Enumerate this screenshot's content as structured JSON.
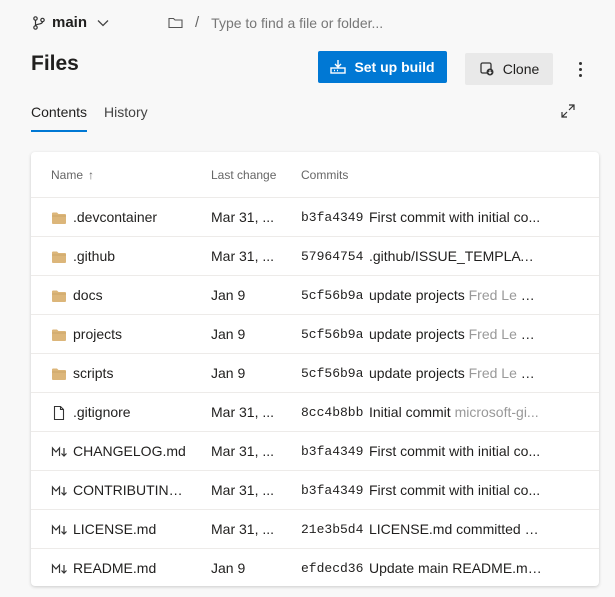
{
  "topbar": {
    "branch": "main",
    "path_placeholder": "Type to find a file or folder...",
    "separator": "/"
  },
  "page": {
    "title": "Files",
    "setup_build_label": "Set up build",
    "clone_label": "Clone"
  },
  "tabs": [
    {
      "label": "Contents",
      "active": true
    },
    {
      "label": "History",
      "active": false
    }
  ],
  "table": {
    "columns": {
      "name": "Name",
      "sort_indicator": "↑",
      "last_change": "Last change",
      "commits": "Commits"
    },
    "rows": [
      {
        "icon": "folder-icon",
        "name": ".devcontainer",
        "last_change": "Mar 31, ...",
        "hash": "b3fa4349",
        "message": "First commit with initial co...",
        "author": ""
      },
      {
        "icon": "folder-icon",
        "name": ".github",
        "last_change": "Mar 31, ...",
        "hash": "57964754",
        "message": ".github/ISSUE_TEMPLATE....",
        "author": ""
      },
      {
        "icon": "folder-icon",
        "name": "docs",
        "last_change": "Jan 9",
        "hash": "5cf56b9a",
        "message": "update projects ",
        "author": "Fred Le C..."
      },
      {
        "icon": "folder-icon",
        "name": "projects",
        "last_change": "Jan 9",
        "hash": "5cf56b9a",
        "message": "update projects ",
        "author": "Fred Le C..."
      },
      {
        "icon": "folder-icon",
        "name": "scripts",
        "last_change": "Jan 9",
        "hash": "5cf56b9a",
        "message": "update projects ",
        "author": "Fred Le C..."
      },
      {
        "icon": "file-icon",
        "name": ".gitignore",
        "last_change": "Mar 31, ...",
        "hash": "8cc4b8bb",
        "message": "Initial commit ",
        "author": "microsoft-gi..."
      },
      {
        "icon": "markdown-icon",
        "name": "CHANGELOG.md",
        "last_change": "Mar 31, ...",
        "hash": "b3fa4349",
        "message": "First commit with initial co...",
        "author": ""
      },
      {
        "icon": "markdown-icon",
        "name": "CONTRIBUTING....",
        "last_change": "Mar 31, ...",
        "hash": "b3fa4349",
        "message": "First commit with initial co...",
        "author": ""
      },
      {
        "icon": "markdown-icon",
        "name": "LICENSE.md",
        "last_change": "Mar 31, ...",
        "hash": "21e3b5d4",
        "message": "LICENSE.md committed ",
        "author": "M..."
      },
      {
        "icon": "markdown-icon",
        "name": "README.md",
        "last_change": "Jan 9",
        "hash": "efdecd36",
        "message": "Update main README.md...",
        "author": ""
      }
    ]
  },
  "colors": {
    "accent": "#0078d4",
    "folder": "#dcb67a",
    "background": "#f8f8f8"
  }
}
